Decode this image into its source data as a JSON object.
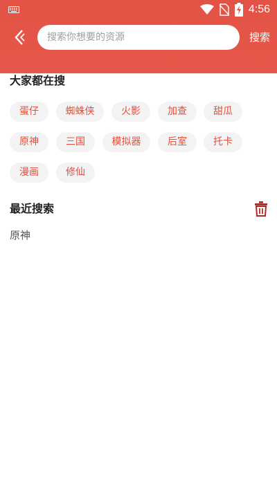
{
  "status": {
    "time": "4:56"
  },
  "header": {
    "search_placeholder": "搜索你想要的资源",
    "search_value": "",
    "search_button": "搜索"
  },
  "hot": {
    "title": "大家都在搜",
    "tags": [
      "蛋仔",
      "蜘蛛侠",
      "火影",
      "加查",
      "甜瓜",
      "原神",
      "三国",
      "模拟器",
      "后室",
      "托卡",
      "漫画",
      "修仙"
    ]
  },
  "recent": {
    "title": "最近搜索",
    "items": [
      "原神"
    ]
  },
  "colors": {
    "accent": "#e25345",
    "tag_text": "#e2503f",
    "tag_bg": "#f3f3f3"
  }
}
